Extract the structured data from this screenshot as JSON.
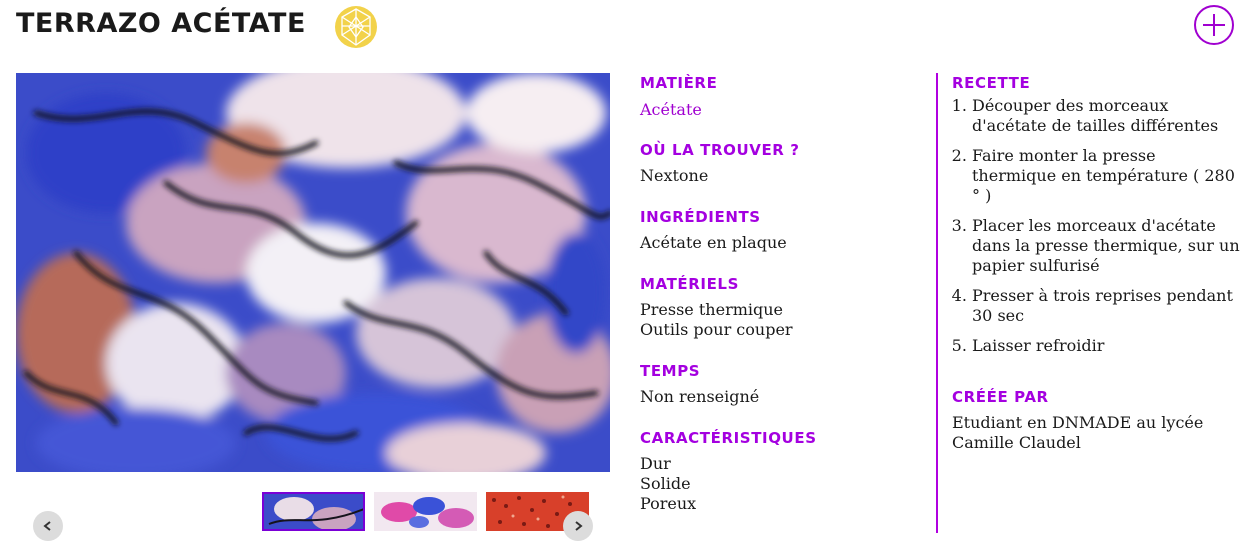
{
  "header": {
    "title": "TERRAZO ACÉTATE",
    "badge_icon": "geodesic-sphere-icon",
    "add_icon": "plus-circle-icon",
    "accent_color": "#a000d0",
    "badge_color": "#f2d24a"
  },
  "gallery": {
    "main_image": "blue-purple-orange-acetate-terrazzo-texture",
    "thumbnails": [
      {
        "name": "thumb-blue-terrazzo",
        "active": true
      },
      {
        "name": "thumb-pink-blue-terrazzo",
        "active": false
      },
      {
        "name": "thumb-red-dotted-terrazzo",
        "active": false
      }
    ],
    "prev_icon": "chevron-left-icon",
    "next_icon": "chevron-right-icon"
  },
  "details": {
    "matiere": {
      "label": "MATIÈRE",
      "value": "Acétate"
    },
    "ou_trouver": {
      "label": "OÙ LA TROUVER ?",
      "value": "Nextone"
    },
    "ingredients": {
      "label": "INGRÉDIENTS",
      "value": "Acétate en plaque"
    },
    "materiels": {
      "label": "MATÉRIELS",
      "values": [
        "Presse thermique",
        "Outils pour couper"
      ]
    },
    "temps": {
      "label": "TEMPS",
      "value": "Non renseigné"
    },
    "caracteristiques": {
      "label": "CARACTÉRISTIQUES",
      "values": [
        "Dur",
        "Solide",
        "Poreux"
      ]
    }
  },
  "recette": {
    "label": "RECETTE",
    "steps": [
      "Découper des morceaux d'acétate de tailles différentes",
      "Faire monter la presse thermique en température ( 280 ° )",
      "Placer les morceaux d'acétate dans la presse thermique, sur un papier sulfurisé",
      "Presser à trois reprises pendant 30 sec",
      "Laisser refroidir"
    ]
  },
  "creee_par": {
    "label": "CRÉÉE PAR",
    "values": [
      "Etudiant en DNMADE au lycée",
      "Camille Claudel"
    ]
  }
}
